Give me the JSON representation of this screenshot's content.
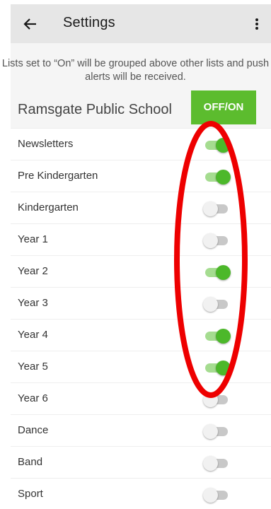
{
  "appbar": {
    "title": "Settings",
    "back_icon": "arrow-left-icon",
    "more_icon": "more-vertical-icon"
  },
  "info": {
    "text": "Lists set to “On” will be grouped above other lists and push alerts will be received."
  },
  "school": {
    "name": "Ramsgate Public School",
    "toggle_all_label": "OFF/ON"
  },
  "colors": {
    "accent_green": "#5cbc2e",
    "toggle_on_thumb": "#4cb82a",
    "toggle_on_track": "#a5dc90",
    "annotation_red": "#ee0000"
  },
  "lists": [
    {
      "label": "Newsletters",
      "on": true
    },
    {
      "label": "Pre Kindergarten",
      "on": true
    },
    {
      "label": "Kindergarten",
      "on": false
    },
    {
      "label": "Year 1",
      "on": false
    },
    {
      "label": "Year 2",
      "on": true
    },
    {
      "label": "Year 3",
      "on": false
    },
    {
      "label": "Year 4",
      "on": true
    },
    {
      "label": "Year 5",
      "on": true
    },
    {
      "label": "Year 6",
      "on": false
    },
    {
      "label": "Dance",
      "on": false
    },
    {
      "label": "Band",
      "on": false
    },
    {
      "label": "Sport",
      "on": false
    }
  ]
}
